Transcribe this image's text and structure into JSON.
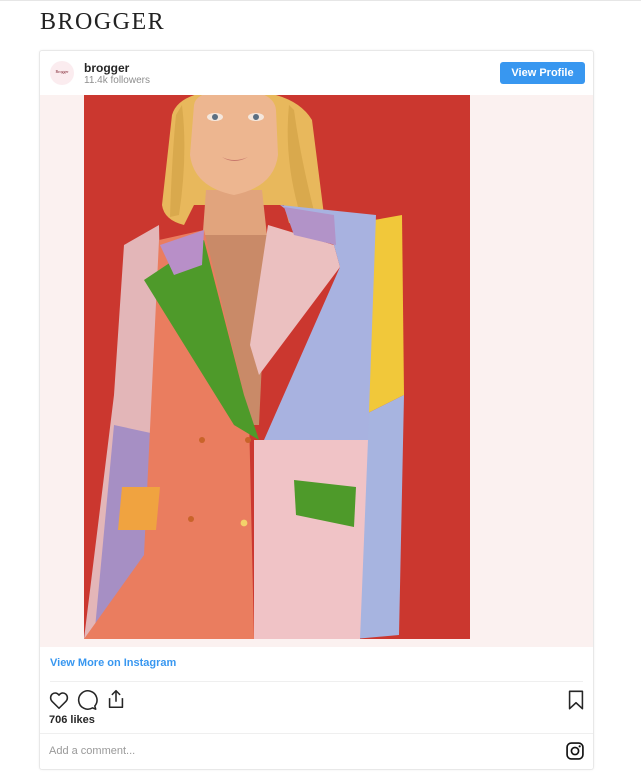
{
  "site": {
    "brand": "BROGGER"
  },
  "post": {
    "avatar_text": "Brogger",
    "username": "brogger",
    "followers": "11.4k followers",
    "view_profile_label": "View Profile",
    "view_more_label": "View More on Instagram",
    "likes": "706 likes",
    "comment_placeholder": "Add a comment...",
    "icons": [
      "heart-icon",
      "comment-icon",
      "share-icon",
      "bookmark-icon",
      "instagram-icon"
    ]
  },
  "colors": {
    "accent": "#3897f0",
    "media_background": "#fbf1f0",
    "photo_background": "#d23a30"
  }
}
